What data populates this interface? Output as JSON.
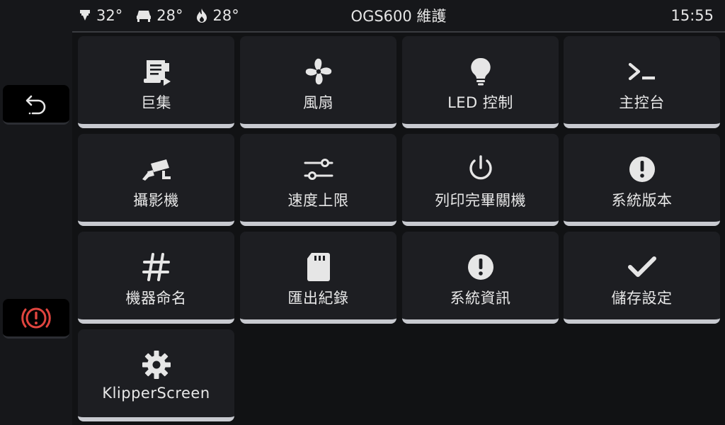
{
  "topbar": {
    "temps": [
      {
        "icon": "extruder-icon",
        "value": "32°"
      },
      {
        "icon": "heated-bed-icon",
        "value": "28°"
      },
      {
        "icon": "flame-icon",
        "value": "28°"
      }
    ],
    "title": "OGS600 維護",
    "clock": "15:55"
  },
  "sidebar": {
    "back_icon": "back-arrow-icon",
    "estop_icon": "emergency-stop-icon",
    "estop_color": "#e0453f"
  },
  "tiles": [
    {
      "label": "巨集",
      "icon": "macro-script-icon"
    },
    {
      "label": "風扇",
      "icon": "fan-icon"
    },
    {
      "label": "LED 控制",
      "icon": "lightbulb-icon"
    },
    {
      "label": "主控台",
      "icon": "console-prompt-icon"
    },
    {
      "label": "攝影機",
      "icon": "camera-icon"
    },
    {
      "label": "速度上限",
      "icon": "sliders-icon"
    },
    {
      "label": "列印完畢關機",
      "icon": "power-icon"
    },
    {
      "label": "系統版本",
      "icon": "alert-circle-icon"
    },
    {
      "label": "機器命名",
      "icon": "hash-icon"
    },
    {
      "label": "匯出紀錄",
      "icon": "sd-card-icon"
    },
    {
      "label": "系統資訊",
      "icon": "alert-circle-icon"
    },
    {
      "label": "儲存設定",
      "icon": "checkmark-icon"
    },
    {
      "label": "KlipperScreen",
      "icon": "gear-icon"
    }
  ]
}
